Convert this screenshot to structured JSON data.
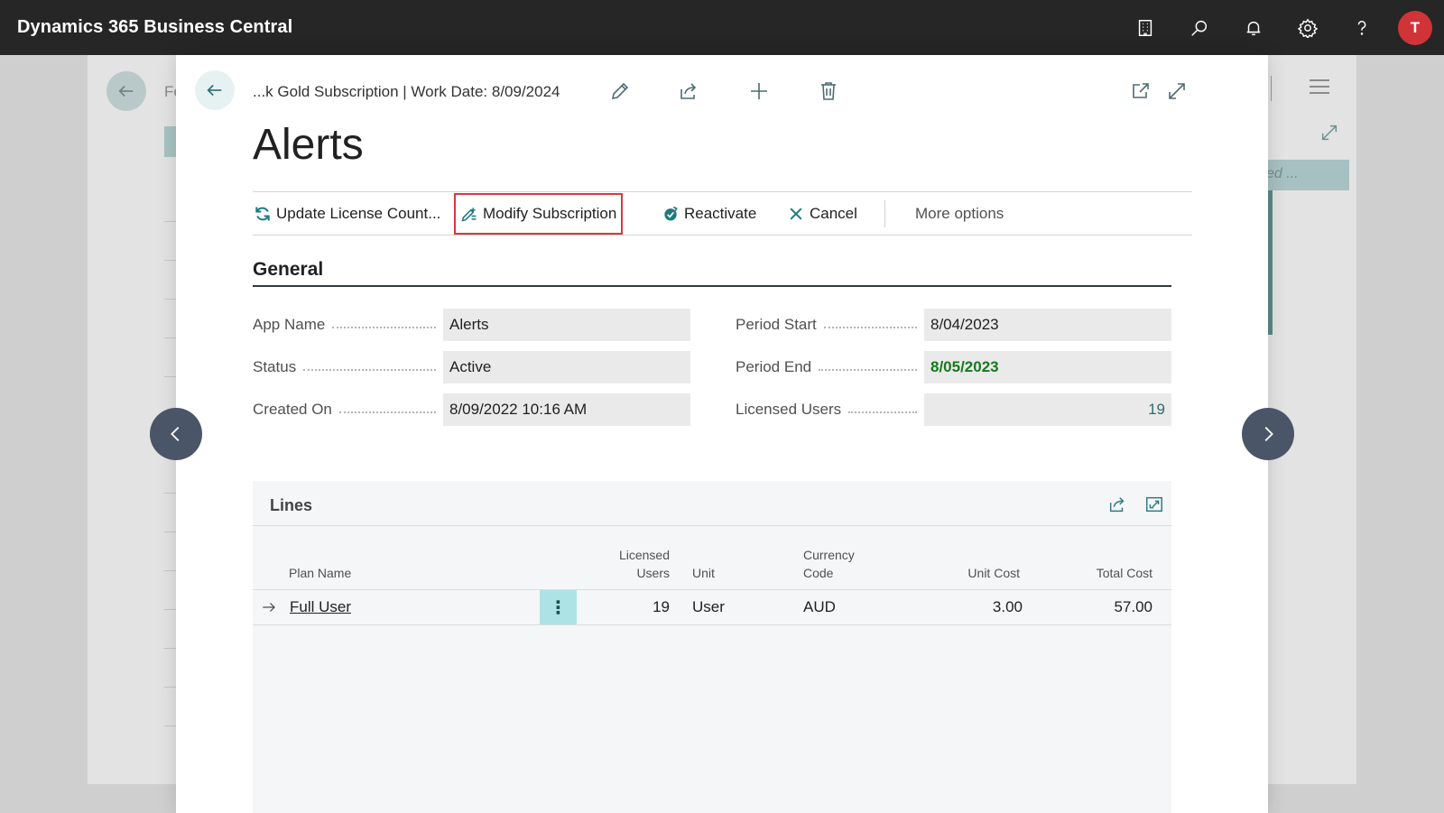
{
  "app": {
    "title": "Dynamics 365 Business Central",
    "avatar_initial": "T",
    "icons": [
      "company-icon",
      "search-icon",
      "bell-icon",
      "gear-icon",
      "help-icon"
    ]
  },
  "background": {
    "partial_text": "Fe",
    "right_tab_text": "ed ..."
  },
  "header": {
    "breadcrumb": "...k Gold Subscription | Work Date: 8/09/2024",
    "icons": [
      "edit-icon",
      "share-icon",
      "add-icon",
      "delete-icon",
      "open-new-window-icon",
      "expand-icon"
    ]
  },
  "page": {
    "title": "Alerts"
  },
  "actions": {
    "update_license": "Update License Count...",
    "modify_subscription": "Modify Subscription",
    "reactivate": "Reactivate",
    "cancel": "Cancel",
    "more_options": "More options",
    "highlight_color": "#d9383c"
  },
  "general": {
    "title": "General",
    "app_name_label": "App Name",
    "app_name_value": "Alerts",
    "status_label": "Status",
    "status_value": "Active",
    "created_on_label": "Created On",
    "created_on_value": "8/09/2022 10:16 AM",
    "period_start_label": "Period Start",
    "period_start_value": "8/04/2023",
    "period_end_label": "Period End",
    "period_end_value": "8/05/2023",
    "licensed_users_label": "Licensed Users",
    "licensed_users_value": "19"
  },
  "lines": {
    "title": "Lines",
    "columns": {
      "plan_name": "Plan Name",
      "licensed_users_1": "Licensed",
      "licensed_users_2": "Users",
      "unit": "Unit",
      "currency_1": "Currency",
      "currency_2": "Code",
      "unit_cost": "Unit Cost",
      "total_cost": "Total Cost"
    },
    "rows": [
      {
        "plan_name": "Full User",
        "licensed_users": "19",
        "unit": "User",
        "currency": "AUD",
        "unit_cost": "3.00",
        "total_cost": "57.00"
      }
    ]
  }
}
